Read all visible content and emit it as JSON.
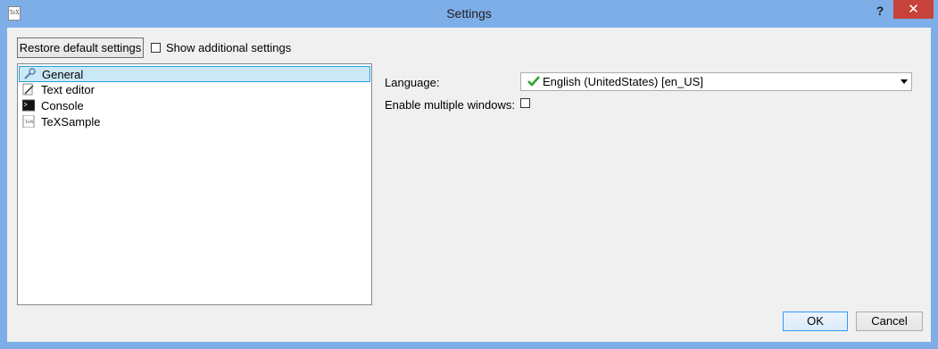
{
  "window": {
    "title": "Settings",
    "help_label": "?",
    "close_label": "✕",
    "icon_text": "TeX"
  },
  "toolbar": {
    "restore_label": "Restore default settings",
    "additional_label": "Show additional settings",
    "additional_checked": false
  },
  "tree": {
    "items": [
      {
        "label": "General",
        "icon": "wrench-icon",
        "selected": true
      },
      {
        "label": "Text editor",
        "icon": "pencil-icon",
        "selected": false
      },
      {
        "label": "Console",
        "icon": "terminal-icon",
        "selected": false
      },
      {
        "label": "TeXSample",
        "icon": "texsample-icon",
        "selected": false
      }
    ]
  },
  "general": {
    "language_label": "Language:",
    "language_value": "English (UnitedStates) [en_US]",
    "multiple_windows_label": "Enable multiple windows:",
    "multiple_windows_checked": false
  },
  "footer": {
    "ok_label": "OK",
    "cancel_label": "Cancel"
  },
  "colors": {
    "titlebar": "#7eaee8",
    "close": "#c7423a",
    "selection": "#cbe8f6",
    "check": "#2aa52a"
  }
}
